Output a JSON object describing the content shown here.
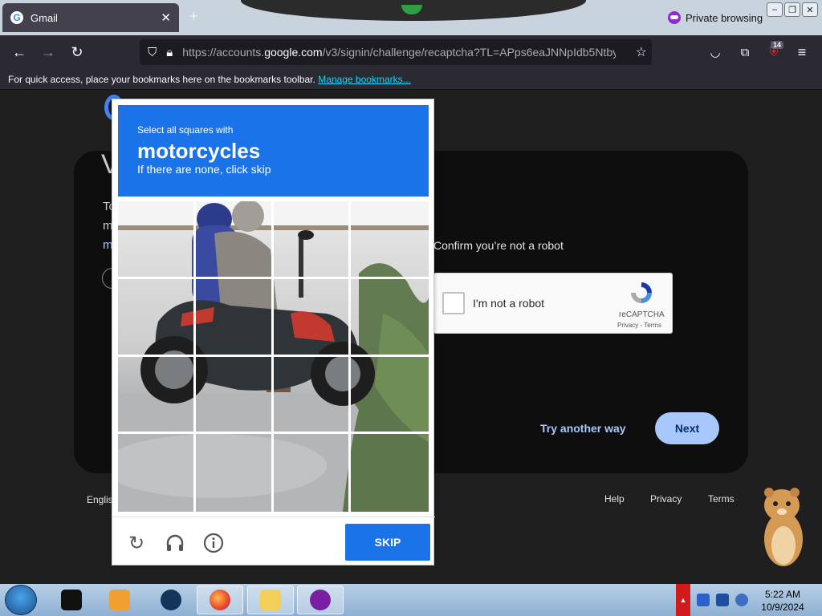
{
  "browser": {
    "tab_title": "Gmail",
    "tab_close": "✕",
    "new_tab": "+",
    "private_label": "Private browsing",
    "url_prefix": "https://accounts.",
    "url_domain": "google.com",
    "url_rest": "/v3/signin/challenge/recaptcha?TL=APps6eaJNNpIdb5NtbyI",
    "extension_badge": "14",
    "bookmarks_text": "For quick access, place your bookmarks here on the bookmarks toolbar.",
    "bookmarks_link": "Manage bookmarks..."
  },
  "signin": {
    "confirm_text": "Confirm you’re not a robot",
    "checkbox_label": "I'm not a robot",
    "recaptcha_brand": "reCAPTCHA",
    "recaptcha_links": "Privacy - Terms",
    "try_another": "Try another way",
    "next": "Next",
    "bg_heading_partial": "V",
    "bg_text_line1": "To",
    "bg_text_line2": "m",
    "bg_text_line3": "m",
    "language": "Englis",
    "footer": {
      "help": "Help",
      "privacy": "Privacy",
      "terms": "Terms"
    }
  },
  "challenge": {
    "select_text": "Select all squares with",
    "object": "motorcycles",
    "none_text": "If there are none, click skip",
    "skip_label": "SKIP",
    "grid_size": 4
  },
  "taskbar": {
    "time": "5:22 AM",
    "date": "10/9/2024"
  },
  "colors": {
    "recaptcha_blue": "#1a73e8",
    "next_button": "#a8c7fa",
    "page_bg": "#1f1f1f",
    "card_bg": "#0e0e0e"
  }
}
